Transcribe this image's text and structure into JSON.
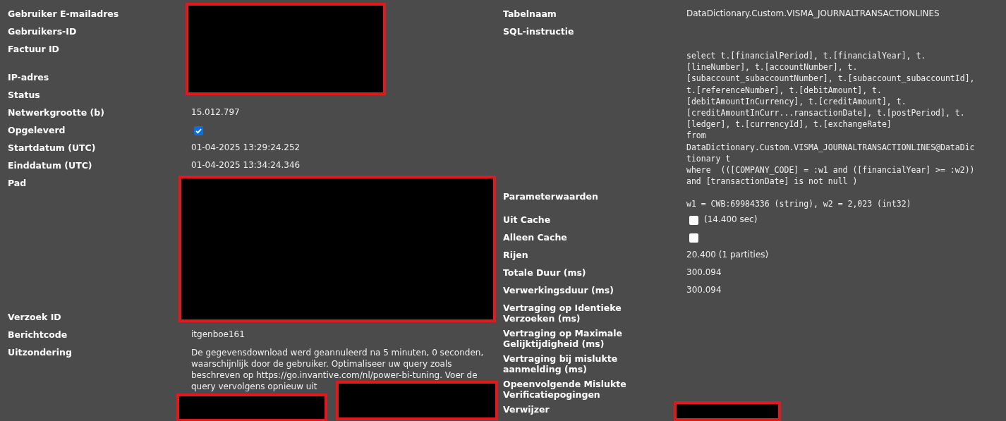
{
  "left": [
    {
      "kind": "redacted_short",
      "labels": [
        "Gebruiker E-mailadres",
        "Gebruikers-ID",
        "Factuur ID",
        "IP-adres",
        "Status"
      ]
    },
    {
      "kind": "text",
      "label": "Netwerkgrootte (b)",
      "value": "15.012.797"
    },
    {
      "kind": "checkbox",
      "label": "Opgeleverd",
      "checked": true
    },
    {
      "kind": "text",
      "label": "Startdatum (UTC)",
      "value": "01-04-2025 13:29:24.252"
    },
    {
      "kind": "text",
      "label": "Einddatum (UTC)",
      "value": "01-04-2025 13:34:24.346"
    },
    {
      "kind": "redacted_long",
      "labels": [
        "Pad",
        "Verzoek ID"
      ]
    },
    {
      "kind": "text",
      "label": "Berichtcode",
      "value": "itgenboe161"
    },
    {
      "kind": "text",
      "label": "Uitzondering",
      "value": "De gegevensdownload werd geannuleerd na 5 minuten, 0 seconden, waarschijnlijk door de gebruiker. Optimaliseer uw query zoals beschreven op https://go.invantive.com/nl/power-bi-tuning. Voer de query vervolgens opnieuw uit",
      "redacted": true
    }
  ],
  "right": [
    {
      "kind": "text",
      "label": "Tabelnaam",
      "value": "DataDictionary.Custom.VISMA_JOURNALTRANSACTIONLINES"
    },
    {
      "kind": "code",
      "label": "SQL-instructie",
      "value": "select t.[financialPeriod], t.[financialYear], t.\n[lineNumber], t.[accountNumber], t.\n[subaccount_subaccountNumber], t.[subaccount_subaccountId],\nt.[referenceNumber], t.[debitAmount], t.\n[debitAmountInCurrency], t.[creditAmount], t.\n[creditAmountInCurr...ransactionDate], t.[postPeriod], t.\n[ledger], t.[currencyId], t.[exchangeRate]\nfrom\nDataDictionary.Custom.VISMA_JOURNALTRANSACTIONLINES@DataDic\ntionary t\nwhere  (([COMPANY_CODE] = :w1 and ([financialYear] >= :w2))\nand [transactionDate] is not null )"
    },
    {
      "kind": "code",
      "label": "Parameterwaarden",
      "value": "w1 = CWB:69984336 (string), w2 = 2,023 (int32)"
    },
    {
      "kind": "checkbox",
      "label": "Uit Cache",
      "checked": false,
      "value": "(14.400 sec)"
    },
    {
      "kind": "checkbox",
      "label": "Alleen Cache",
      "checked": false
    },
    {
      "kind": "text",
      "label": "Rijen",
      "value": "20.400 (1 partities)"
    },
    {
      "kind": "text",
      "label": "Totale Duur (ms)",
      "value": "300.094"
    },
    {
      "kind": "text",
      "label": "Verwerkingsduur (ms)",
      "value": "300.094"
    },
    {
      "kind": "text",
      "label": "Vertraging op Identieke Verzoeken (ms)"
    },
    {
      "kind": "text",
      "label": "Vertraging op Maximale Gelijktijdigheid (ms)"
    },
    {
      "kind": "text",
      "label": "Vertraging bij mislukte aanmelding (ms)"
    },
    {
      "kind": "text",
      "label": "Opeenvolgende Mislukte Verificatiepogingen"
    },
    {
      "kind": "redacted_field",
      "label": "Verwijzer"
    }
  ]
}
